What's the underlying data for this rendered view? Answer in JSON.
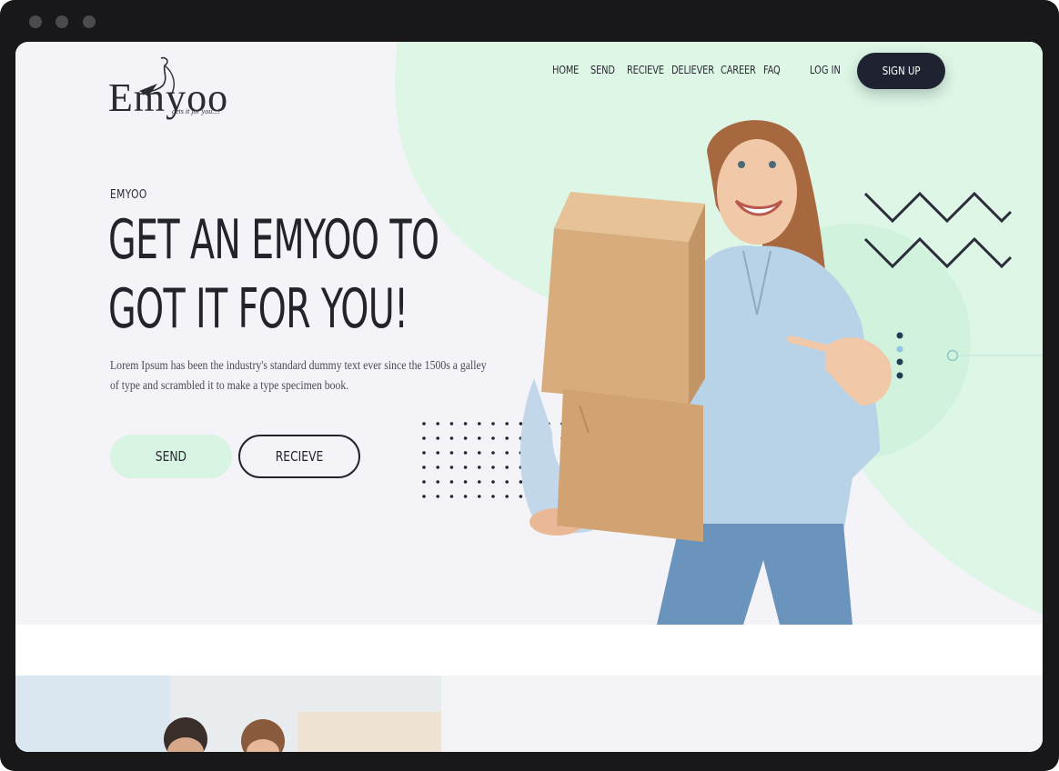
{
  "brand": {
    "name": "Emyoo",
    "tagline": "gets it for you...!"
  },
  "nav": {
    "items": [
      "HOME",
      "SEND",
      "RECIEVE",
      "DELIEVER",
      "CAREER",
      "FAQ"
    ],
    "login": "LOG IN",
    "signup": "SIGN UP"
  },
  "hero": {
    "eyebrow": "EMYOO",
    "headline_line1": "GET AN EMYOO TO",
    "headline_line2": "GOT IT FOR YOU!",
    "lead": "Lorem Ipsum has been the industry's standard dummy text ever since the 1500s a galley of type and scrambled it to make a type specimen book.",
    "btn_send": "SEND",
    "btn_recieve": "RECIEVE"
  },
  "colors": {
    "accent_green": "#d8f4e2",
    "dark": "#1f2230",
    "background": "#f4f4f8"
  },
  "icons": [
    "zigzag-decoration-icon",
    "dot-grid-decoration-icon",
    "vertical-dots-icon"
  ]
}
